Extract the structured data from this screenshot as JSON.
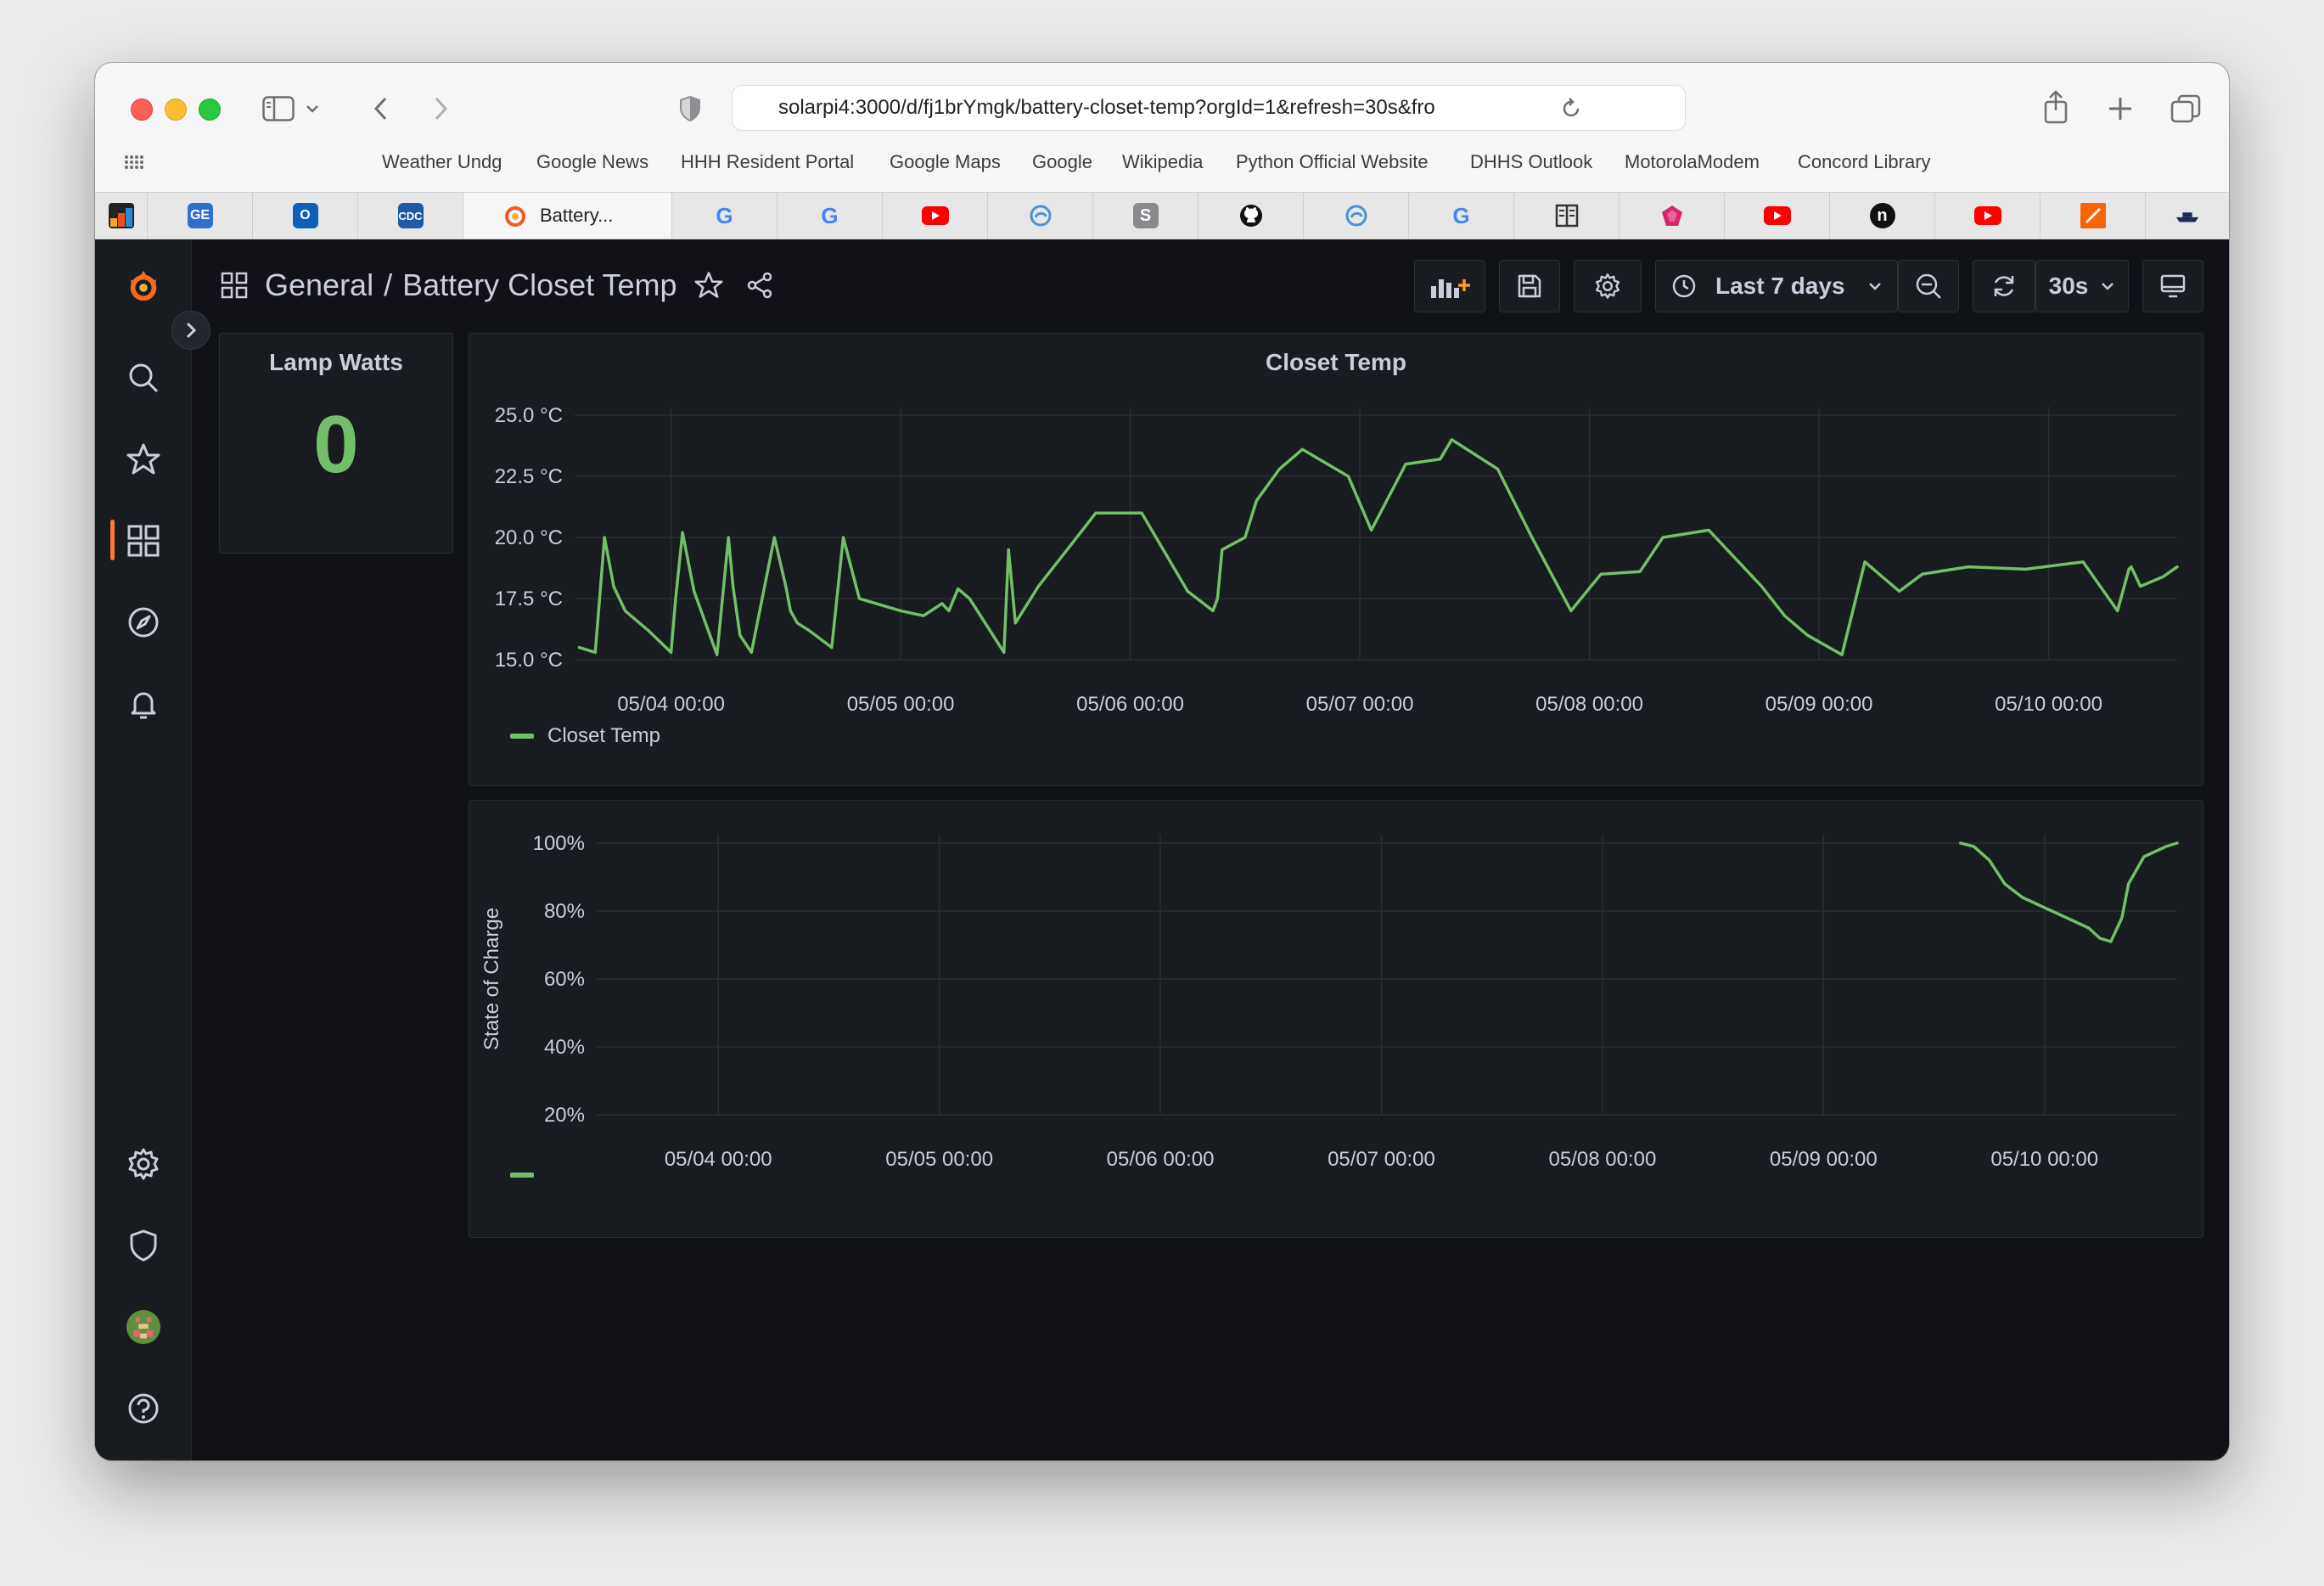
{
  "browser": {
    "url": "solarpi4:3000/d/fj1brYmgk/battery-closet-temp?orgId=1&refresh=30s&fro",
    "bookmarks": [
      "Weather Undg",
      "Google News",
      "HHH Resident Portal",
      "Google Maps",
      "Google",
      "Wikipedia",
      "Python Official Website",
      "DHHS Outlook",
      "MotorolaModem",
      "Concord Library"
    ],
    "active_tab_title": "Battery...",
    "tab_favicons": [
      "wu-icon",
      "ge-icon",
      "outlook-icon",
      "cdc-icon",
      "grafana-icon",
      "google-icon",
      "google-icon",
      "youtube-icon",
      "edge-icon",
      "s-icon",
      "github-icon",
      "edge-icon",
      "google-icon",
      "reader-icon",
      "gem-icon",
      "youtube-icon",
      "n-icon",
      "youtube-icon",
      "home-depot-icon",
      "boat-icon"
    ]
  },
  "dashboard": {
    "folder": "General",
    "separator": "/",
    "title": "Battery Closet Temp",
    "time_range": "Last 7 days",
    "refresh_interval": "30s"
  },
  "colors": {
    "series": "#73bf69",
    "accent": "#ff7b30",
    "background": "#111217",
    "panel": "#181b1f"
  },
  "panels": {
    "lamp": {
      "title": "Lamp Watts",
      "value": "0"
    },
    "closet": {
      "title": "Closet Temp",
      "legend": "Closet Temp"
    },
    "battery": {
      "title": "",
      "legend": ""
    }
  },
  "chart_data": [
    {
      "type": "line",
      "title": "Closet Temp",
      "xlabel": "",
      "ylabel": "",
      "ylim": [
        15.0,
        25.0
      ],
      "yticks": [
        "15.0 °C",
        "17.5 °C",
        "20.0 °C",
        "22.5 °C",
        "25.0 °C"
      ],
      "ytick_values": [
        15.0,
        17.5,
        20.0,
        22.5,
        25.0
      ],
      "xlim": [
        -0.42,
        6.56
      ],
      "xticks": [
        "05/04 00:00",
        "05/05 00:00",
        "05/06 00:00",
        "05/07 00:00",
        "05/08 00:00",
        "05/09 00:00",
        "05/10 00:00"
      ],
      "xtick_values": [
        0,
        1,
        2,
        3,
        4,
        5,
        6
      ],
      "grid": true,
      "legend": "bottom-left",
      "series": [
        {
          "name": "Closet Temp",
          "x": [
            -0.4,
            -0.33,
            -0.29,
            -0.25,
            -0.2,
            -0.1,
            0.0,
            0.02,
            0.05,
            0.1,
            0.2,
            0.25,
            0.27,
            0.3,
            0.35,
            0.45,
            0.5,
            0.52,
            0.55,
            0.6,
            0.7,
            0.75,
            0.82,
            1.0,
            1.1,
            1.18,
            1.21,
            1.25,
            1.3,
            1.45,
            1.47,
            1.5,
            1.6,
            1.75,
            1.85,
            2.05,
            2.25,
            2.36,
            2.38,
            2.4,
            2.5,
            2.55,
            2.65,
            2.75,
            2.95,
            3.05,
            3.2,
            3.35,
            3.4,
            3.45,
            3.6,
            3.75,
            3.92,
            4.05,
            4.22,
            4.32,
            4.52,
            4.75,
            4.85,
            4.95,
            5.1,
            5.2,
            5.35,
            5.45,
            5.65,
            5.9,
            6.15,
            6.3,
            6.35,
            6.36,
            6.4,
            6.5,
            6.56
          ],
          "y": [
            15.5,
            15.3,
            20.0,
            18.0,
            17.0,
            16.2,
            15.3,
            17.5,
            20.2,
            17.8,
            15.2,
            20.0,
            18.0,
            16.0,
            15.3,
            20.0,
            18.0,
            17.0,
            16.5,
            16.2,
            15.5,
            20.0,
            17.5,
            17.0,
            16.8,
            17.3,
            17.0,
            17.9,
            17.5,
            15.3,
            19.5,
            16.5,
            18.0,
            19.8,
            21.0,
            21.0,
            17.8,
            17.0,
            17.5,
            19.5,
            20.0,
            21.5,
            22.8,
            23.6,
            22.5,
            20.3,
            23.0,
            23.2,
            24.0,
            23.7,
            22.8,
            20.0,
            17.0,
            18.5,
            18.6,
            20.0,
            20.3,
            18.0,
            16.8,
            16.0,
            15.2,
            19.0,
            17.8,
            18.5,
            18.8,
            18.7,
            19.0,
            17.0,
            18.7,
            18.8,
            18.0,
            18.4,
            18.8
          ]
        }
      ]
    },
    {
      "type": "line",
      "title": "",
      "xlabel": "",
      "ylabel": "State of Charge",
      "ylim": [
        20,
        100
      ],
      "yticks": [
        "20%",
        "40%",
        "60%",
        "80%",
        "100%"
      ],
      "ytick_values": [
        20,
        40,
        60,
        80,
        100
      ],
      "xlim": [
        -0.55,
        6.6
      ],
      "xticks": [
        "05/04 00:00",
        "05/05 00:00",
        "05/06 00:00",
        "05/07 00:00",
        "05/08 00:00",
        "05/09 00:00",
        "05/10 00:00"
      ],
      "xtick_values": [
        0,
        1,
        2,
        3,
        4,
        5,
        6
      ],
      "grid": true,
      "legend": "bottom-left",
      "series": [
        {
          "x": [
            5.62,
            5.68,
            5.75,
            5.82,
            5.9,
            6.0,
            6.1,
            6.2,
            6.25,
            6.3,
            6.35,
            6.38,
            6.45,
            6.55,
            6.6
          ],
          "y": [
            100,
            99,
            95,
            88,
            84,
            81,
            78,
            75,
            72,
            71,
            78,
            88,
            96,
            99,
            100
          ]
        }
      ]
    }
  ]
}
